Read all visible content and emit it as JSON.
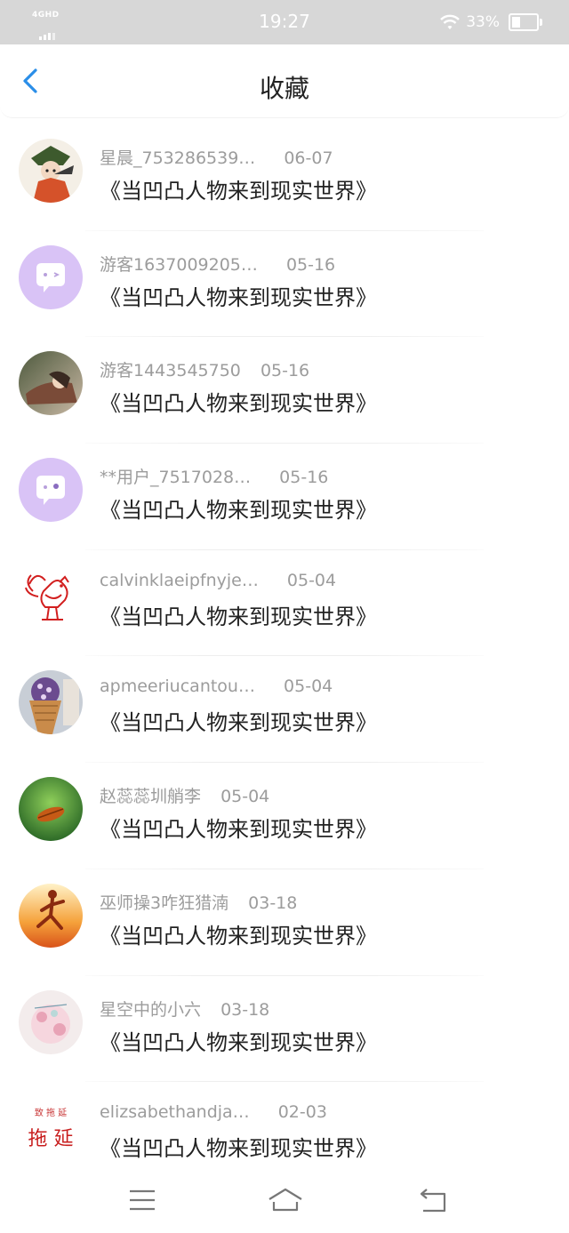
{
  "status_bar": {
    "network": "4GHD",
    "time": "19:27",
    "battery": "33%"
  },
  "header": {
    "title": "收藏",
    "back_icon": "chevron-left-icon"
  },
  "favorites": [
    {
      "user": "星晨_753286539…",
      "date": "06-07",
      "title": "《当凹凸人物来到现实世界》",
      "avatar": "anime-character-avatar"
    },
    {
      "user": "游客1637009205…",
      "date": "05-16",
      "title": "《当凹凸人物来到现实世界》",
      "avatar": "default-purple-chat-avatar"
    },
    {
      "user": "游客1443545750",
      "date": "05-16",
      "title": "《当凹凸人物来到现实世界》",
      "avatar": "anime-portrait-avatar"
    },
    {
      "user": "**用户_7517028…",
      "date": "05-16",
      "title": "《当凹凸人物来到现实世界》",
      "avatar": "default-purple-chat-avatar"
    },
    {
      "user": "calvinklaeipfnyje…",
      "date": "05-04",
      "title": "《当凹凸人物来到现实世界》",
      "avatar": "red-rooster-papercut-avatar"
    },
    {
      "user": "apmeeriucantou…",
      "date": "05-04",
      "title": "《当凹凸人物来到现实世界》",
      "avatar": "ice-cream-cone-avatar"
    },
    {
      "user": "赵蕊蕊圳艄李",
      "date": "05-04",
      "title": "《当凹凸人物来到现实世界》",
      "avatar": "green-leaf-insect-avatar"
    },
    {
      "user": "巫师操3咋狂猎湳",
      "date": "03-18",
      "title": "《当凹凸人物来到现实世界》",
      "avatar": "runner-sunset-avatar"
    },
    {
      "user": "星空中的小六",
      "date": "03-18",
      "title": "《当凹凸人物来到现实世界》",
      "avatar": "pink-floral-illustration-avatar"
    },
    {
      "user": "elizsabethandja…",
      "date": "02-03",
      "title": "《当凹凸人物来到现实世界》",
      "avatar": "calligraphy-text-avatar"
    }
  ],
  "avatar_text": {
    "calligraphy_small": "致 拖 延",
    "calligraphy_big": "拖 延"
  },
  "bottom_nav": {
    "menu_icon": "menu-icon",
    "home_icon": "home-icon",
    "back_icon": "return-icon"
  },
  "colors": {
    "accent": "#2a8ee8",
    "purple_avatar": "#d9c3f6",
    "status_bar": "#d7d7d7"
  }
}
